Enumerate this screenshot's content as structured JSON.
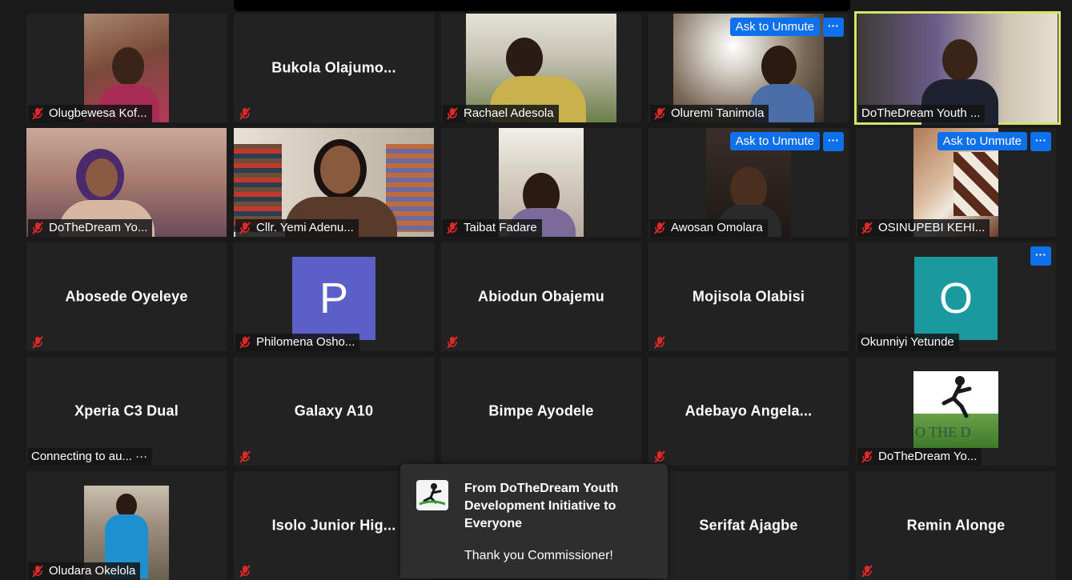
{
  "tiles": [
    {
      "name": "Olugbewesa Kof...",
      "mute": true
    },
    {
      "name": "Bukola  Olajumo...",
      "center": "Bukola  Olajumo...",
      "mute": true
    },
    {
      "name": "Rachael Adesola",
      "mute": true
    },
    {
      "name": "Oluremi Tanimola",
      "mute": true,
      "ask_unmute": "Ask to Unmute",
      "more": "···"
    },
    {
      "name": "DoTheDream Youth ...",
      "mute": false
    },
    {
      "name": "DoTheDream Yo...",
      "mute": true
    },
    {
      "name": "Cllr. Yemi Adenu...",
      "mute": true
    },
    {
      "name": "Taibat Fadare",
      "mute": true
    },
    {
      "name": "Awosan Omolara",
      "mute": true,
      "ask_unmute": "Ask to Unmute",
      "more": "···"
    },
    {
      "name": "OSINUPEBI KEHI...",
      "mute": true,
      "ask_unmute": "Ask to Unmute",
      "more": "···"
    },
    {
      "center": "Abosede Oyeleye",
      "mute": true
    },
    {
      "name": "Philomena Osho...",
      "avatar": "P",
      "mute": true
    },
    {
      "center": "Abiodun Obajemu",
      "mute": true
    },
    {
      "center": "Mojisola Olabisi",
      "mute": true
    },
    {
      "name": "Okunniyi Yetunde",
      "avatar": "O",
      "mute": false,
      "more": "···"
    },
    {
      "center": "Xperia C3 Dual",
      "status": "Connecting to au... ···"
    },
    {
      "center": "Galaxy A10",
      "mute": true
    },
    {
      "center": "Bimpe Ayodele"
    },
    {
      "center": "Adebayo  Angela...",
      "mute": true
    },
    {
      "name": "DoTheDream Yo...",
      "mute": true
    },
    {
      "name": "Oludara Okelola",
      "mute": true
    },
    {
      "center": "Isolo Junior Hig...",
      "mute": true
    },
    {},
    {
      "center": "Serifat Ajagbe"
    },
    {
      "center": "Remin Alonge",
      "mute": true
    }
  ],
  "chat": {
    "from": "From DoTheDream Youth Development Initiative to Everyone",
    "message": "Thank you Commissioner!"
  },
  "colors": {
    "accent": "#0e71eb",
    "active_border": "#d6e36a",
    "mute_red": "#e02828",
    "avatar_p": "#5b5fc7",
    "avatar_o": "#1a9a9e"
  }
}
